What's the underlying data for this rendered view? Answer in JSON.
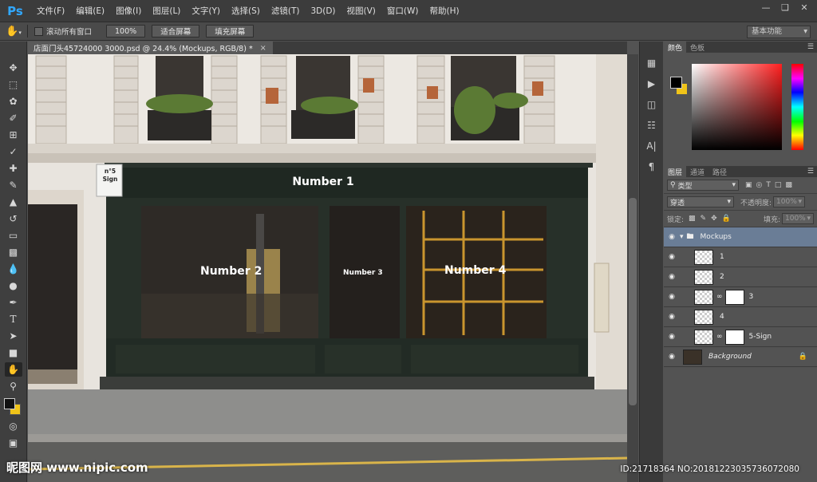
{
  "app": {
    "logo": "Ps"
  },
  "menu": [
    "文件(F)",
    "编辑(E)",
    "图像(I)",
    "图层(L)",
    "文字(Y)",
    "选择(S)",
    "滤镜(T)",
    "3D(D)",
    "视图(V)",
    "窗口(W)",
    "帮助(H)"
  ],
  "window_controls": [
    "minimize-icon",
    "restore-icon",
    "close-icon"
  ],
  "options": {
    "scroll_all": "滚动所有窗口",
    "zoom_100": "100%",
    "fit_screen": "适合屏幕",
    "fill_screen": "填充屏幕",
    "workspace": "基本功能"
  },
  "document": {
    "tab_title": "店面门头45724000 3000.psd @ 24.4% (Mockups, RGB/8) *"
  },
  "canvas_text": {
    "sign_small": "n°5 Sign",
    "number1": "Number 1",
    "number2": "Number 2",
    "number3": "Number 3",
    "number4": "Number 4"
  },
  "color_panel": {
    "tabs": [
      "颜色",
      "色板"
    ],
    "fg": "#000000",
    "bg": "#f0c419"
  },
  "layers_panel": {
    "tabs": [
      "图层",
      "通道",
      "路径"
    ],
    "filter": "类型",
    "blend_mode": "穿透",
    "opacity_label": "不透明度:",
    "opacity": "100%",
    "lock_label": "锁定:",
    "fill_label": "填充:",
    "fill": "100%",
    "layers": [
      {
        "name": "Mockups",
        "kind": "group"
      },
      {
        "name": "1",
        "kind": "smart"
      },
      {
        "name": "2",
        "kind": "smart"
      },
      {
        "name": "3",
        "kind": "smart-mask"
      },
      {
        "name": "4",
        "kind": "smart"
      },
      {
        "name": "5-Sign",
        "kind": "smart-mask"
      },
      {
        "name": "Background",
        "kind": "background"
      }
    ]
  },
  "watermarks": {
    "left": "昵图网 www.nipic.com",
    "right": "ID:21718364 NO:20181223035736072080"
  }
}
